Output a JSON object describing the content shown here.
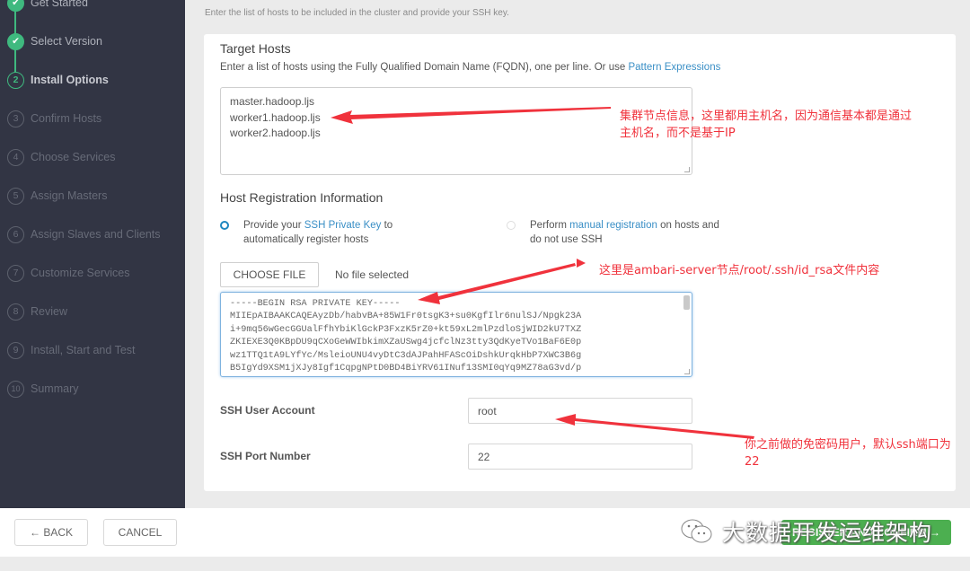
{
  "sidebar": {
    "steps": [
      {
        "label": "Get Started",
        "marker": "✔",
        "state": "done"
      },
      {
        "label": "Select Version",
        "marker": "✔",
        "state": "done"
      },
      {
        "label": "Install Options",
        "marker": "2",
        "state": "current"
      },
      {
        "label": "Confirm Hosts",
        "marker": "3",
        "state": "pending"
      },
      {
        "label": "Choose Services",
        "marker": "4",
        "state": "pending"
      },
      {
        "label": "Assign Masters",
        "marker": "5",
        "state": "pending"
      },
      {
        "label": "Assign Slaves and Clients",
        "marker": "6",
        "state": "pending"
      },
      {
        "label": "Customize Services",
        "marker": "7",
        "state": "pending"
      },
      {
        "label": "Review",
        "marker": "8",
        "state": "pending"
      },
      {
        "label": "Install, Start and Test",
        "marker": "9",
        "state": "pending"
      },
      {
        "label": "Summary",
        "marker": "10",
        "state": "pending"
      }
    ]
  },
  "main": {
    "intro": "Enter the list of hosts to be included in the cluster and provide your SSH key.",
    "target_hosts": {
      "title": "Target Hosts",
      "desc_prefix": "Enter a list of hosts using the Fully Qualified Domain Name (FQDN), one per line. Or use ",
      "desc_link": "Pattern Expressions",
      "hosts_value": "master.hadoop.ljs\nworker1.hadoop.ljs\nworker2.hadoop.ljs"
    },
    "registration": {
      "title": "Host Registration Information",
      "option_ssh": {
        "prefix": "Provide your ",
        "link": "SSH Private Key",
        "suffix": " to",
        "line2": "automatically register hosts",
        "selected": true
      },
      "option_manual": {
        "prefix": "Perform ",
        "link": "manual registration",
        "suffix": " on hosts and",
        "line2": "do not use SSH",
        "selected": false
      },
      "choose_file_label": "CHOOSE FILE",
      "file_status": "No file selected",
      "private_key_value": "-----BEGIN RSA PRIVATE KEY-----\nMIIEpAIBAAKCAQEAyzDb/habvBA+85W1Fr0tsgK3+su0KgfIlr6nulSJ/Npgk23A\ni+9mq56wGecGGUalFfhYbiKlGckP3FxzK5rZ0+kt59xL2mlPzdloSjWID2kU7TXZ\nZKIEXE3Q0KBpDU9qCXoGeWWIbkimXZaUSwg4jcfclNz3tty3QdKyeTVo1BaF6E0p\nwz1TTQ1tA9LYfYc/MsleioUNU4vyDtC3dAJPahHFAScOiDshkUrqkHbP7XWC3B6g\nB5IgYd9XSM1jXJy8Igf1CqpgNPtD0BD4BiYRV61INuf13SMI0qYq9MZ78aG3vd/p",
      "ssh_user_label": "SSH User Account",
      "ssh_user_value": "root",
      "ssh_port_label": "SSH Port Number",
      "ssh_port_value": "22"
    }
  },
  "footer": {
    "back_label": "← BACK",
    "cancel_label": "CANCEL",
    "primary_label": "REGISTER AND CONFIRM →"
  },
  "annotations": {
    "hosts_note": "集群节点信息，这里都用主机名，因为通信基本都是通过\n主机名，而不是基于IP",
    "key_note": "这里是ambari-server节点/root/.ssh/id_rsa文件内容",
    "user_note": "你之前做的免密码用户，默认ssh端口为\n22",
    "watermark": "大数据开发运维架构",
    "color": "#f0323c"
  },
  "colors": {
    "sidebar_bg": "#323544",
    "step_done": "#3fb97f",
    "link": "#3a8fc6",
    "primary_button": "#4caf50"
  }
}
